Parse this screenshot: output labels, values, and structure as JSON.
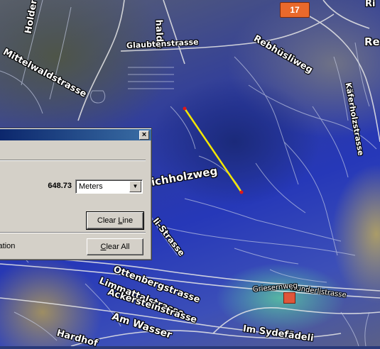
{
  "map": {
    "route_shield": "17",
    "streets": [
      {
        "id": "holderbach",
        "label": "Holderba"
      },
      {
        "id": "mittelwaldstrasse",
        "label": "Mittelwaldstrasse"
      },
      {
        "id": "halde",
        "label": "halde"
      },
      {
        "id": "glaubtenstrasse",
        "label": "Glaubtenstrasse"
      },
      {
        "id": "rebhuesliweg",
        "label": "Rebhüsliweg"
      },
      {
        "id": "kaeferholzstrasse",
        "label": "Käferholzstrasse"
      },
      {
        "id": "wichholzweg",
        "label": "ichholzweg"
      },
      {
        "id": "li-strasse",
        "label": "li-Strasse"
      },
      {
        "id": "ottenbergstrasse",
        "label": "Ottenbergstrasse"
      },
      {
        "id": "limmattalstrasse",
        "label": "Limmattalstrasse"
      },
      {
        "id": "ackersteinstrasse",
        "label": "Ackersteinstrasse"
      },
      {
        "id": "am-wasser",
        "label": "Am Wasser"
      },
      {
        "id": "hardhof",
        "label": "Hardhof"
      },
      {
        "id": "im-sydefaedeli",
        "label": "Im Sydefädeli"
      },
      {
        "id": "wunderlistrasse",
        "label": "Wunderlistrasse"
      },
      {
        "id": "griesernweg",
        "label": "Griesernweg"
      },
      {
        "id": "re-top",
        "label": "Re"
      },
      {
        "id": "re-top2",
        "label": "Ri"
      }
    ]
  },
  "dialog": {
    "close_symbol": "×",
    "measurement_value": "648.73",
    "units_selected": "Meters",
    "units_arrow": "▼",
    "clear_line_prefix": "Clear ",
    "clear_line_hotkey": "L",
    "clear_line_suffix": "ine",
    "clear_all_prefix": "",
    "clear_all_hotkey": "C",
    "clear_all_suffix": "lear All",
    "navigation_label": "igation"
  },
  "colors": {
    "measure_line": "#f2e600",
    "measure_point": "#e01818",
    "titlebar": "#0a246a",
    "dialog_bg": "#d4d0c8"
  }
}
